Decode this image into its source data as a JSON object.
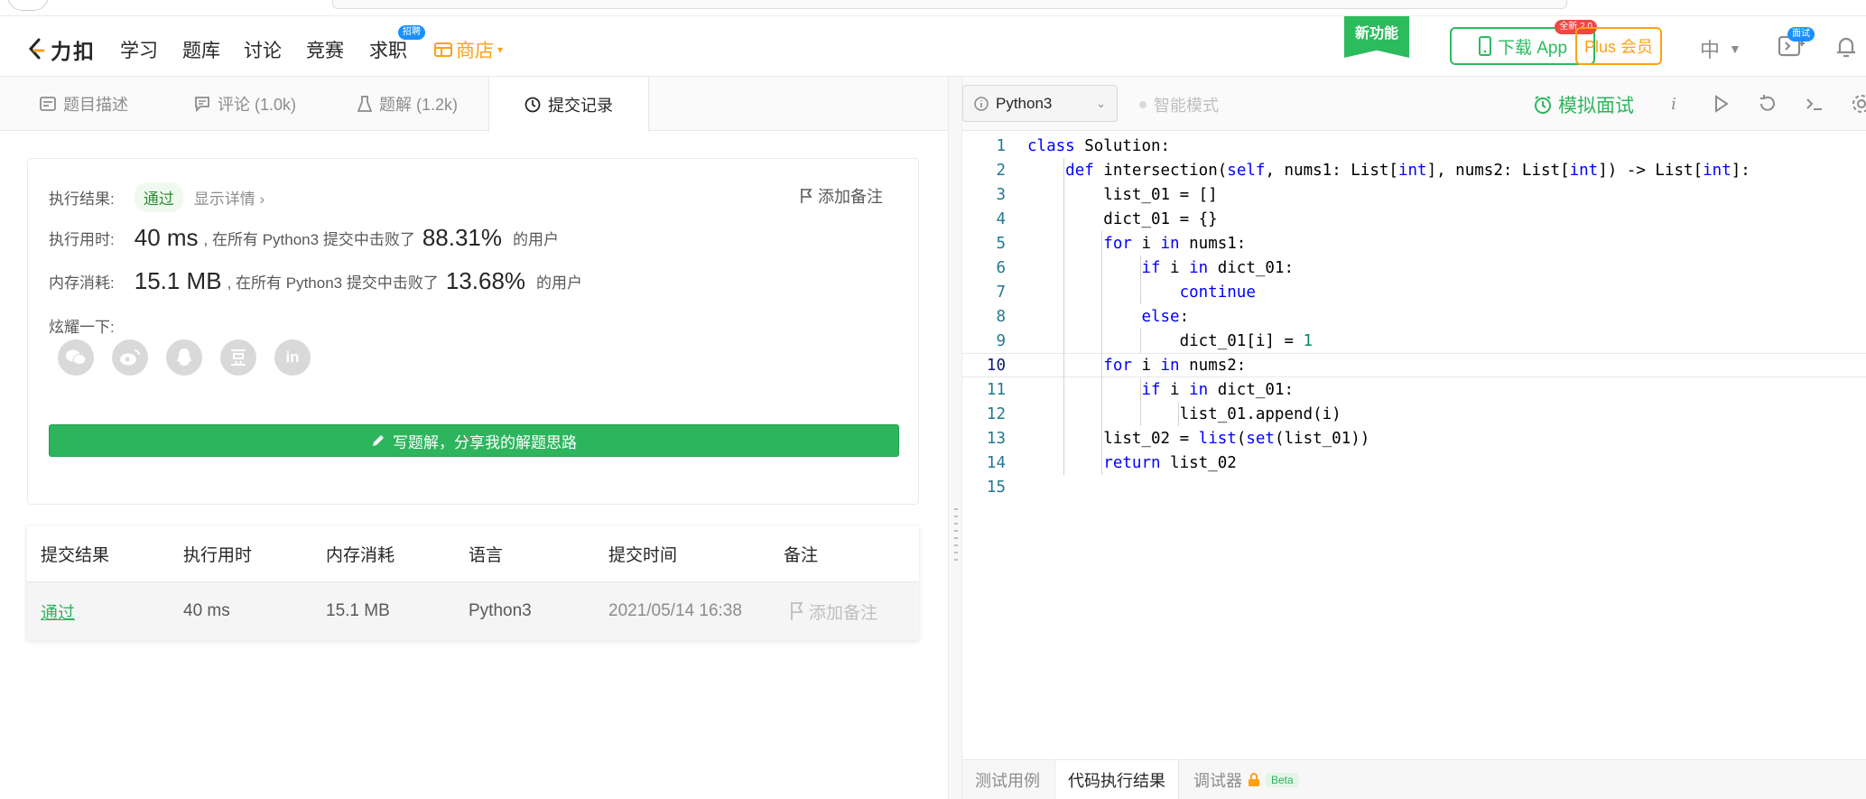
{
  "nav": {
    "logo_text": "力扣",
    "items": [
      "学习",
      "题库",
      "讨论",
      "竞赛",
      "求职"
    ],
    "job_badge": "招聘",
    "shop": "商店",
    "new_feature": "新功能",
    "download_app": "下载 App",
    "download_badge": "全新 2.0",
    "plus": "Plus 会员",
    "lang": "中",
    "interview_badge": "面试"
  },
  "left_tabs": [
    {
      "label": "题目描述"
    },
    {
      "label": "评论 (1.0k)"
    },
    {
      "label": "题解 (1.2k)"
    },
    {
      "label": "提交记录"
    }
  ],
  "result": {
    "result_label": "执行结果:",
    "status": "通过",
    "show_detail": "显示详情",
    "add_note": "添加备注",
    "runtime_label": "执行用时:",
    "runtime_value": "40 ms",
    "runtime_text": ", 在所有 Python3 提交中击败了",
    "runtime_pct": "88.31%",
    "runtime_suffix": "的用户",
    "memory_label": "内存消耗:",
    "memory_value": "15.1 MB",
    "memory_text": ", 在所有 Python3 提交中击败了",
    "memory_pct": "13.68%",
    "memory_suffix": "的用户",
    "share_label": "炫耀一下:",
    "write_button": "写题解，分享我的解题思路"
  },
  "table": {
    "headers": [
      "提交结果",
      "执行用时",
      "内存消耗",
      "语言",
      "提交时间",
      "备注"
    ],
    "rows": [
      {
        "result": "通过",
        "runtime": "40 ms",
        "memory": "15.1 MB",
        "lang": "Python3",
        "time": "2021/05/14 16:38",
        "note": "添加备注"
      }
    ]
  },
  "editor": {
    "language": "Python3",
    "smart_mode": "智能模式",
    "mock_interview": "模拟面试",
    "info_btn": "i",
    "code_lines": [
      "class Solution:",
      "    def intersection(self, nums1: List[int], nums2: List[int]) -> List[int]:",
      "        list_01 = []",
      "        dict_01 = {}",
      "        for i in nums1:",
      "            if i in dict_01:",
      "                continue",
      "            else:",
      "                dict_01[i] = 1",
      "        for i in nums2:",
      "            if i in dict_01:",
      "                list_01.append(i)",
      "        list_02 = list(set(list_01))",
      "        return list_02",
      ""
    ],
    "current_line": 10
  },
  "console_tabs": [
    {
      "label": "测试用例"
    },
    {
      "label": "代码执行结果"
    },
    {
      "label": "调试器"
    }
  ],
  "console_beta": "Beta",
  "colors": {
    "brand_green": "#2cbb5d",
    "shop_orange": "#ffa116",
    "badge_blue": "#1a90ff"
  }
}
